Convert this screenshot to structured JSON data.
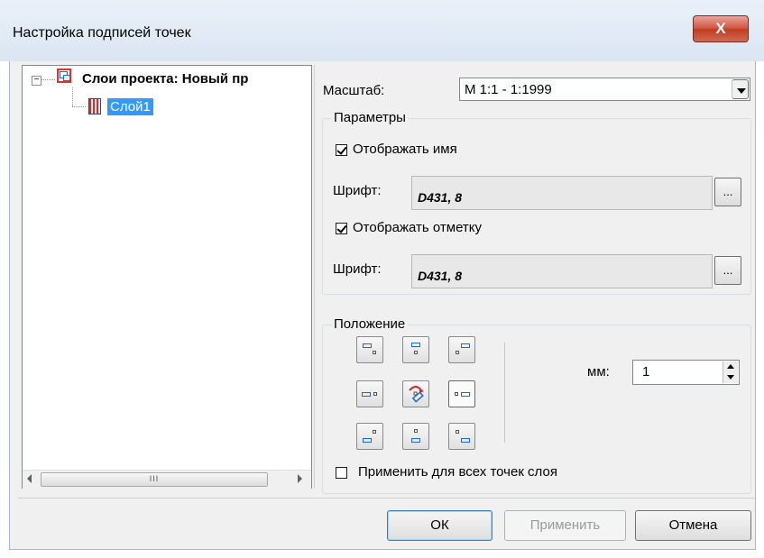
{
  "window": {
    "title": "Настройка подписей точек",
    "close_label": "X"
  },
  "tree": {
    "expander": "−",
    "root_label": "Слои проекта: Новый пр",
    "child_label": "Слой1",
    "scroll_thumb_label": "III"
  },
  "scale": {
    "label": "Масштаб:",
    "value": "М 1:1 - 1:1999"
  },
  "params": {
    "title": "Параметры",
    "show_name": {
      "label": "Отображать имя",
      "checked": true
    },
    "font1": {
      "label": "Шрифт:",
      "value": "D431, 8",
      "button": "..."
    },
    "show_mark": {
      "label": "Отображать отметку",
      "checked": true
    },
    "font2": {
      "label": "Шрифт:",
      "value": "D431, 8",
      "button": "..."
    }
  },
  "position": {
    "title": "Положение",
    "mm_label": "мм:",
    "mm_value": "1",
    "apply_all": {
      "label": "Применить для всех точек слоя",
      "checked": false
    },
    "grid": [
      "top-left",
      "top-center",
      "top-right",
      "middle-left",
      "center-rotate",
      "middle-right",
      "bottom-left",
      "bottom-center",
      "bottom-right"
    ],
    "selected": "middle-right"
  },
  "buttons": {
    "ok": "ОК",
    "apply": "Применить",
    "cancel": "Отмена"
  },
  "colors": {
    "selection": "#3399ff",
    "label_blue": "#1f66d1",
    "close_red": "#c13b22"
  }
}
